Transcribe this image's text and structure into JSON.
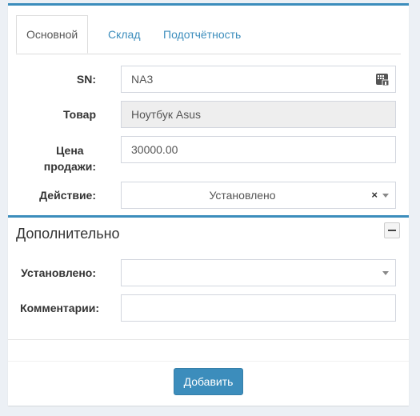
{
  "tabs": [
    {
      "label": "Основной",
      "active": true
    },
    {
      "label": "Склад",
      "active": false
    },
    {
      "label": "Подотчётность",
      "active": false
    }
  ],
  "form": {
    "sn": {
      "label": "SN:",
      "value": "NA3",
      "button_icon": "keypad-icon"
    },
    "product": {
      "label": "Товар",
      "value": "Ноутбук Asus"
    },
    "price": {
      "label_line1": "Цена",
      "label_line2": "продажи:",
      "value": "30000.00"
    },
    "action": {
      "label": "Действие:",
      "value": "Установлено",
      "clear": "×"
    }
  },
  "additional": {
    "title": "Дополнительно",
    "installed": {
      "label": "Установлено:",
      "value": ""
    },
    "comments": {
      "label": "Комментарии:",
      "value": ""
    }
  },
  "footer": {
    "add_label": "Добавить"
  },
  "colors": {
    "accent": "#3c8dbc",
    "background": "#ecf0f5"
  }
}
